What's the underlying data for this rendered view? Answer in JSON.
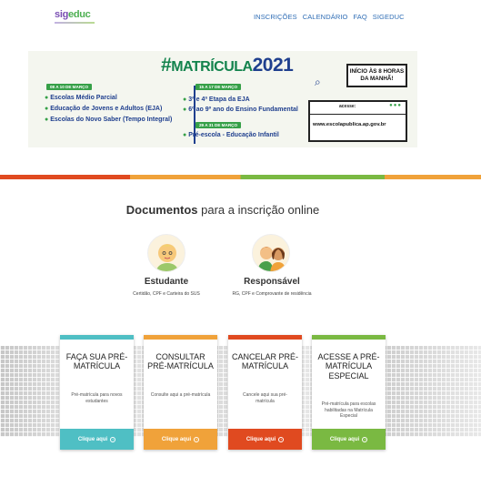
{
  "header": {
    "logo_part1": "sig",
    "logo_part2": "educ",
    "nav": [
      "INSCRIÇÕES",
      "CALENDÁRIO",
      "FAQ",
      "SIGEDUC"
    ]
  },
  "banner": {
    "hashtag": "#",
    "title_word": "MATRÍCULA",
    "title_year": "2021",
    "period1": "08 A 10 DE MARÇO",
    "items1": [
      "Escolas Médio Parcial",
      "Educação de Jovens e Adultos (EJA)",
      "Escolas do Novo Saber (Tempo Integral)"
    ],
    "period2": "15 A 17 DE MARÇO",
    "items2": [
      "3ª e 4ª Etapa da EJA",
      "6º ao 9º ano do Ensino Fundamental"
    ],
    "period3": "29 A 31 DE MARÇO",
    "items3": [
      "Pré-escola - Educação Infantil"
    ],
    "start_notice": "INÍCIO ÀS 8 HORAS DA MANHÃ!",
    "access_label": "acesse:",
    "url": "www.escolapublica.ap.gov.br"
  },
  "documents": {
    "title_bold": "Documentos",
    "title_rest": "para a inscrição online",
    "people": [
      {
        "name": "Estudante",
        "desc": "Certidão, CPF e Carteira do SUS"
      },
      {
        "name": "Responsável",
        "desc": "RG, CPF e Comprovante de residência"
      }
    ]
  },
  "cards": [
    {
      "title": "FAÇA SUA PRÉ-MATRÍCULA",
      "desc": "Pré-matrícula para novos estudantes",
      "button": "Clique aqui",
      "color": "#4fbfc4"
    },
    {
      "title": "CONSULTAR PRÉ-MATRÍCULA",
      "desc": "Consulte aqui a pré-matrícula",
      "button": "Clique aqui",
      "color": "#f0a23a"
    },
    {
      "title": "CANCELAR PRÉ-MATRÍCULA",
      "desc": "Cancele aqui sua pré-matrícula",
      "button": "Clique aqui",
      "color": "#e04a20"
    },
    {
      "title": "ACESSE A PRÉ-MATRÍCULA ESPECIAL",
      "desc": "Pré-matrícula para escolas habilitadas na Matrícula Especial",
      "button": "Clique aqui",
      "color": "#7ab942"
    }
  ]
}
